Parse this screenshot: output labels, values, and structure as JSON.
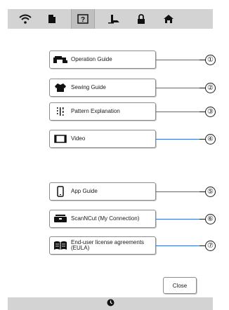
{
  "toolbar": {
    "icons": [
      "wifi-icon",
      "document-icon",
      "help-icon",
      "foot-pedal-icon",
      "lock-icon",
      "home-icon"
    ],
    "active": "help-icon"
  },
  "guides": [
    {
      "label": "Operation Guide",
      "icon": "sewing-machine-icon",
      "marker": "①"
    },
    {
      "label": "Sewing Guide",
      "icon": "shirt-icon",
      "marker": "②"
    },
    {
      "label": "Pattern Explanation",
      "icon": "stitch-pattern-icon",
      "marker": "③"
    },
    {
      "label": "Video",
      "icon": "video-frame-icon",
      "marker": "④"
    },
    {
      "label": "App Guide",
      "icon": "smartphone-icon",
      "marker": "⑤"
    },
    {
      "label": "ScanNCut (My Connection)",
      "icon": "scanncut-icon",
      "marker": "⑥"
    },
    {
      "label": "End-user license agreements\n(EULA)",
      "icon": "book-icon",
      "marker": "⑦"
    }
  ],
  "close_label": "Close",
  "bottombar": {
    "icon": "clock-icon"
  },
  "colors": {
    "bar": "#d3d3d3",
    "leader": "#2e6fd9"
  }
}
